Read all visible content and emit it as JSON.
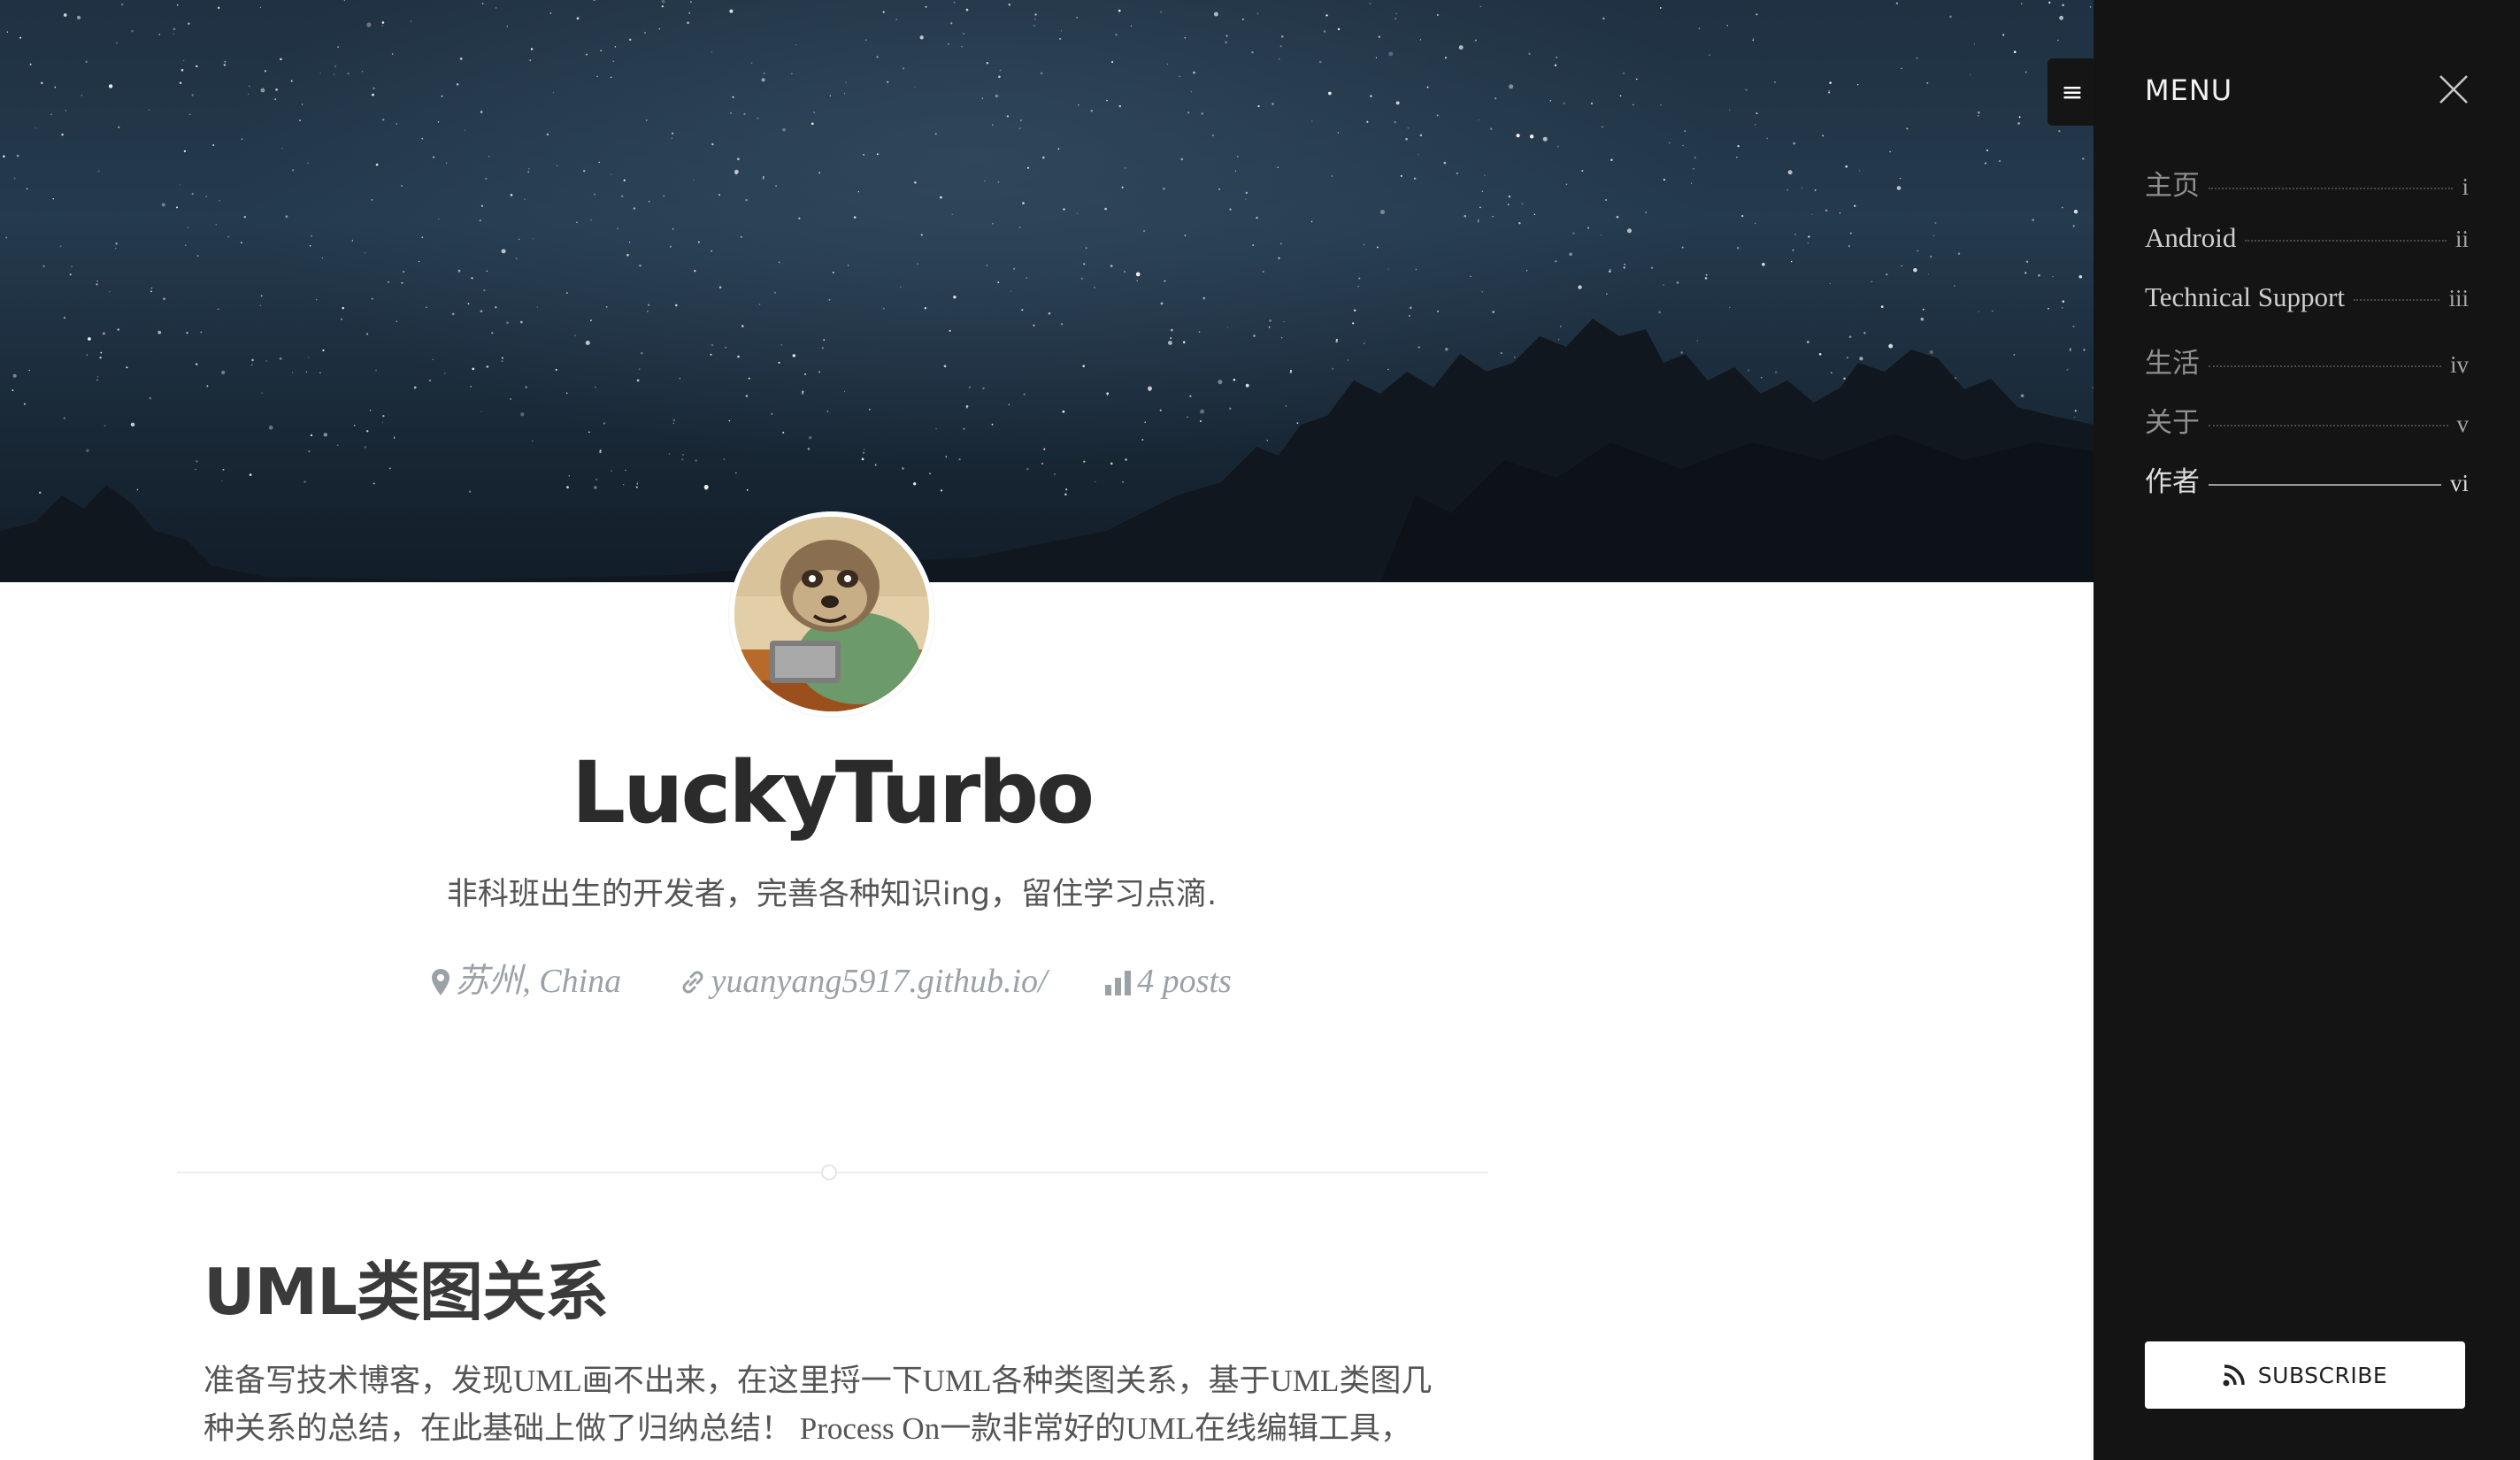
{
  "colors": {
    "page_background": "#ffffff",
    "menu_background": "#141414",
    "title_text": "#2b2b2b",
    "meta_text": "#9aa2a8",
    "subscribe_background": "#ffffff"
  },
  "header": {
    "title": "LuckyTurbo",
    "description": "非科班出生的开发者，完善各种知识ing，留住学习点滴.",
    "location": "苏州, China",
    "website": "yuanyang5917.github.io/",
    "posts": "4 posts",
    "icons": {
      "location": "map-marker-icon",
      "website": "link-icon",
      "posts": "bar-chart-icon"
    }
  },
  "post": {
    "title": "UML类图关系",
    "excerpt": "准备写技术博客，发现UML画不出来，在这里捋一下UML各种类图关系，基于UML类图几种关系的总结，在此基础上做了归纳总结！ Process On一款非常好的UML在线编辑工具，made in"
  },
  "menu_toggle": {
    "icon": "hamburger-icon",
    "glyph": "≡"
  },
  "menu": {
    "title": "MENU",
    "close_icon": "close-icon",
    "items": [
      {
        "label": "主页",
        "num": "i"
      },
      {
        "label": "Android",
        "num": "ii"
      },
      {
        "label": "Technical Support",
        "num": "iii"
      },
      {
        "label": "生活",
        "num": "iv"
      },
      {
        "label": "关于",
        "num": "v"
      },
      {
        "label": "作者",
        "num": "vi"
      }
    ],
    "current_item": "作者",
    "subscribe_label": "SUBSCRIBE",
    "subscribe_icon": "rss-icon"
  }
}
